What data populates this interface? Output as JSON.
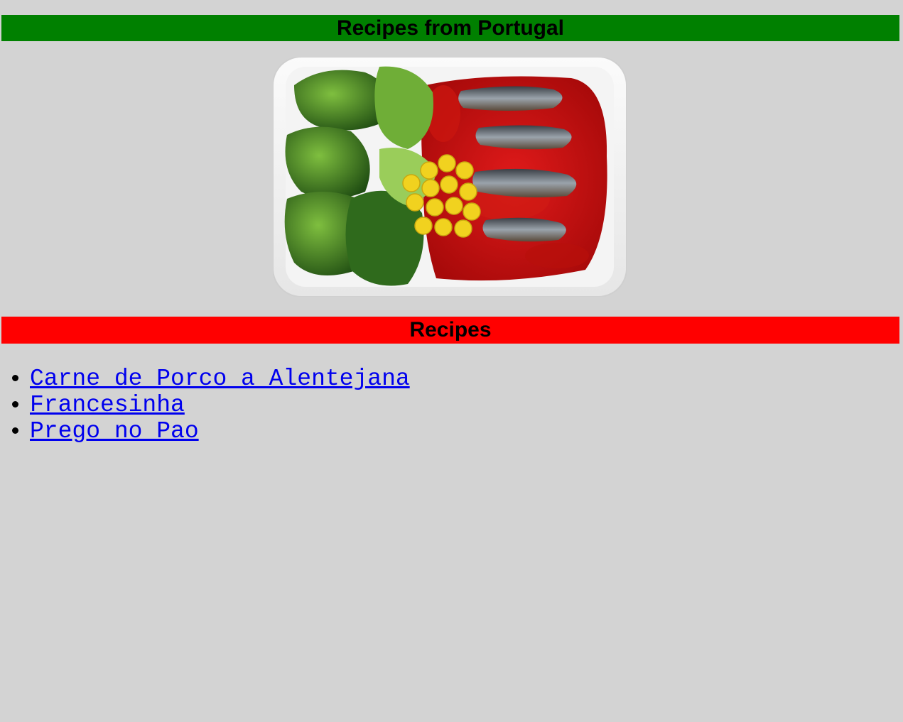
{
  "header": {
    "title": "Recipes from Portugal",
    "bg_color": "#008000"
  },
  "hero_image": {
    "icon": "portuguese-dish-photo"
  },
  "recipes_section": {
    "title": "Recipes",
    "bg_color": "#ff0000",
    "link_color": "#0000ee",
    "items": [
      {
        "label": "Carne de Porco a Alentejana"
      },
      {
        "label": "Francesinha"
      },
      {
        "label": "Prego no Pao"
      }
    ]
  }
}
